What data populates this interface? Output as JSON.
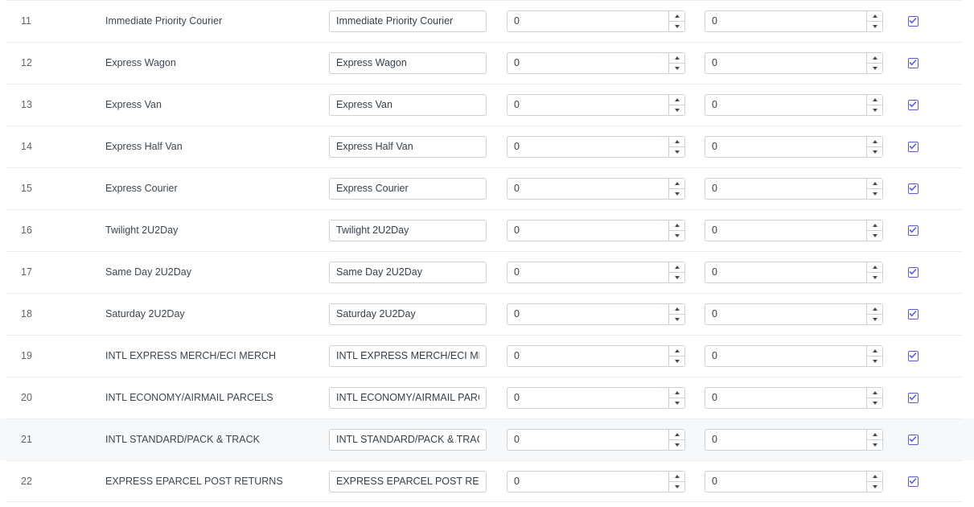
{
  "table": {
    "highlighted_row_index": 21,
    "colors": {
      "row_highlight": "#f7f8fa",
      "divider": "#eceef1",
      "input_border": "#c9d1db",
      "checkbox_accent": "#5b5bd6",
      "label_text": "#3d4651",
      "index_text": "#5a6572"
    },
    "checkbox_icon": "checkmark-icon",
    "spinner_up_icon": "triangle-up-icon",
    "spinner_down_icon": "triangle-down-icon",
    "rows": [
      {
        "index": "11",
        "label": "Immediate Priority Courier",
        "name_value": "Immediate Priority Courier",
        "num_a": "0",
        "num_b": "0",
        "checked": true
      },
      {
        "index": "12",
        "label": "Express Wagon",
        "name_value": "Express Wagon",
        "num_a": "0",
        "num_b": "0",
        "checked": true
      },
      {
        "index": "13",
        "label": "Express Van",
        "name_value": "Express Van",
        "num_a": "0",
        "num_b": "0",
        "checked": true
      },
      {
        "index": "14",
        "label": "Express Half Van",
        "name_value": "Express Half Van",
        "num_a": "0",
        "num_b": "0",
        "checked": true
      },
      {
        "index": "15",
        "label": "Express Courier",
        "name_value": "Express Courier",
        "num_a": "0",
        "num_b": "0",
        "checked": true
      },
      {
        "index": "16",
        "label": "Twilight 2U2Day",
        "name_value": "Twilight 2U2Day",
        "num_a": "0",
        "num_b": "0",
        "checked": true
      },
      {
        "index": "17",
        "label": "Same Day 2U2Day",
        "name_value": "Same Day 2U2Day",
        "num_a": "0",
        "num_b": "0",
        "checked": true
      },
      {
        "index": "18",
        "label": "Saturday 2U2Day",
        "name_value": "Saturday 2U2Day",
        "num_a": "0",
        "num_b": "0",
        "checked": true
      },
      {
        "index": "19",
        "label": "INTL EXPRESS MERCH/ECI MERCH",
        "name_value": "INTL EXPRESS MERCH/ECI MERCH",
        "num_a": "0",
        "num_b": "0",
        "checked": true
      },
      {
        "index": "20",
        "label": "INTL ECONOMY/AIRMAIL PARCELS",
        "name_value": "INTL ECONOMY/AIRMAIL PARCELS",
        "num_a": "0",
        "num_b": "0",
        "checked": true
      },
      {
        "index": "21",
        "label": "INTL STANDARD/PACK & TRACK",
        "name_value": "INTL STANDARD/PACK & TRACK",
        "num_a": "0",
        "num_b": "0",
        "checked": true
      },
      {
        "index": "22",
        "label": "EXPRESS EPARCEL POST RETURNS",
        "name_value": "EXPRESS EPARCEL POST RETURNS",
        "num_a": "0",
        "num_b": "0",
        "checked": true
      }
    ]
  }
}
